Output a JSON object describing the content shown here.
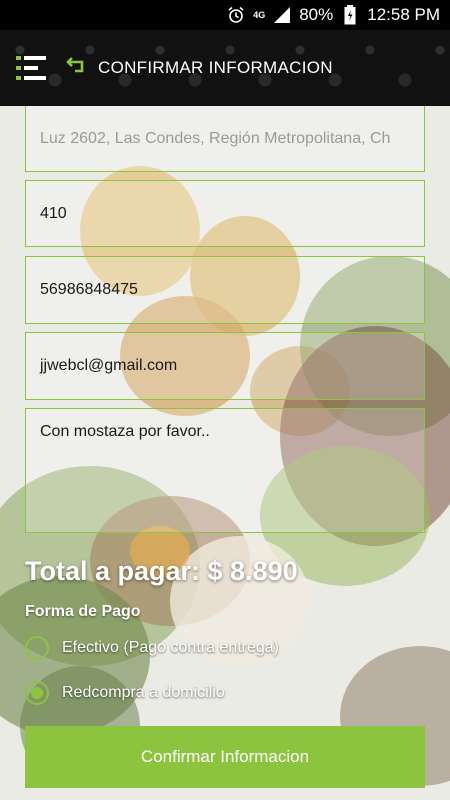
{
  "status_bar": {
    "network": "4G",
    "battery": "80%",
    "time": "12:58 PM"
  },
  "header": {
    "title": "CONFIRMAR INFORMACION"
  },
  "form": {
    "address": "Luz 2602, Las Condes, Región Metropolitana, Ch",
    "number": "410",
    "phone": "56986848475",
    "email": "jjwebcl@gmail.com",
    "comments": "Con mostaza por favor.."
  },
  "total": {
    "label": "Total a pagar: $ 8.890"
  },
  "payment": {
    "label": "Forma de Pago",
    "options": [
      {
        "label": "Efectivo (Pago contra entrega)",
        "selected": false
      },
      {
        "label": "Redcompra a domicilio",
        "selected": true
      }
    ]
  },
  "confirm_button": {
    "label": "Confirmar Informacion"
  },
  "colors": {
    "accent": "#8dc43f",
    "header_bg": "#111111"
  }
}
